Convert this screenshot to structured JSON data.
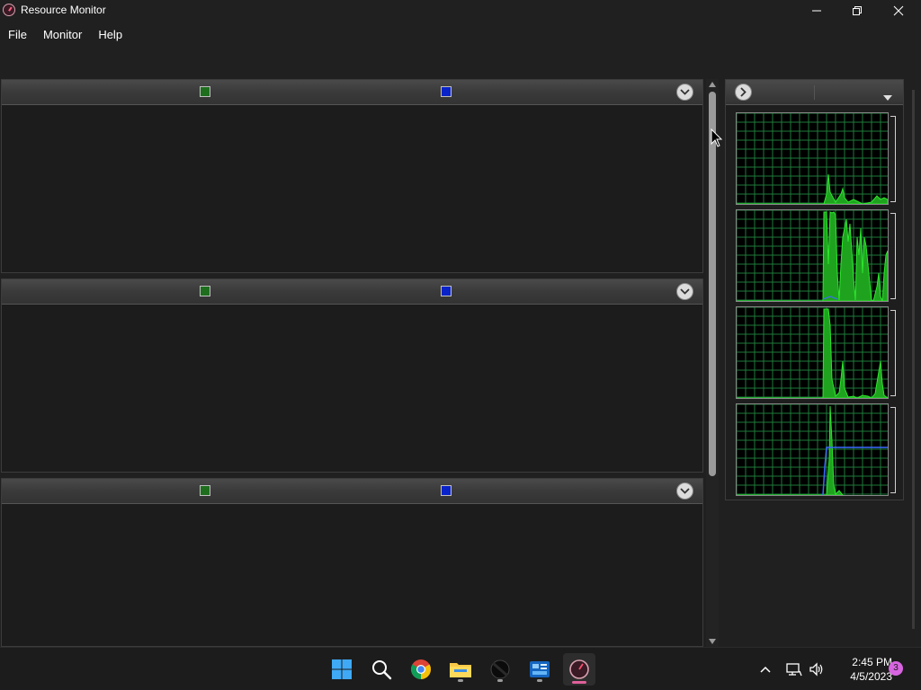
{
  "window": {
    "title": "Resource Monitor"
  },
  "menu": {
    "items": [
      "File",
      "Monitor",
      "Help"
    ]
  },
  "panes": [
    {
      "id": "pane-1",
      "legend": [
        "green",
        "blue"
      ]
    },
    {
      "id": "pane-2",
      "legend": [
        "green",
        "blue"
      ]
    },
    {
      "id": "pane-3",
      "legend": [
        "green",
        "blue"
      ]
    }
  ],
  "graphs": {
    "count": 4,
    "line_color": "#2ee62e",
    "fill_color": "#1fa31f",
    "secondary_color": "#3b6bff",
    "grid_color": "#1e7a3a"
  },
  "colors": {
    "legend_green": "#1e6e1e",
    "legend_blue": "#0a23c8",
    "background": "#202020",
    "pane_background": "#1c1c1c"
  },
  "taskbar": {
    "apps": [
      {
        "name": "start",
        "icon": "windows-logo-icon"
      },
      {
        "name": "search",
        "icon": "search-icon"
      },
      {
        "name": "chrome",
        "icon": "chrome-icon"
      },
      {
        "name": "file-explorer",
        "icon": "folder-icon"
      },
      {
        "name": "app-dark",
        "icon": "dark-orb-icon"
      },
      {
        "name": "app-blue",
        "icon": "blue-app-icon"
      },
      {
        "name": "resource-monitor",
        "icon": "resource-monitor-icon"
      }
    ],
    "clock": {
      "time": "2:45 PM",
      "date": "4/5/2023"
    },
    "notifications": "3"
  }
}
